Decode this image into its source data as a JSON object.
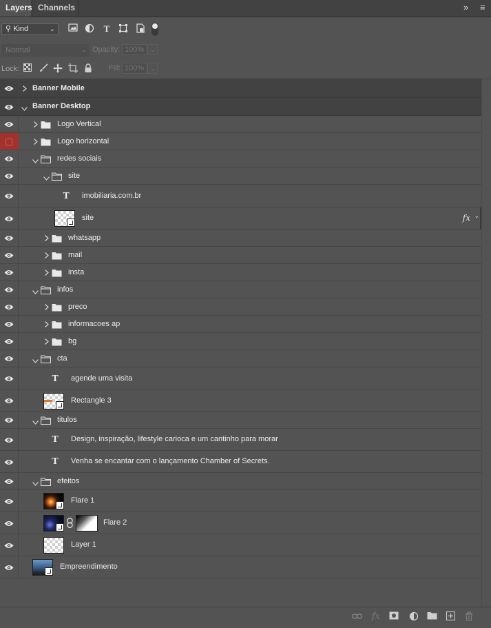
{
  "tabs": [
    {
      "label": "Layers",
      "active": true
    },
    {
      "label": "Channels",
      "active": false
    }
  ],
  "panel_menu": {
    "collapse_glyph": "»",
    "menu_glyph": "≡"
  },
  "filter": {
    "kind_label": "Kind",
    "filter_icons": [
      "image-filter-icon",
      "adjustment-filter-icon",
      "type-filter-icon",
      "shape-filter-icon",
      "smart-object-filter-icon",
      "filter-toggle-icon"
    ]
  },
  "blend": {
    "mode": "Normal",
    "opacity_label": "Opacity:",
    "opacity_value": "100%"
  },
  "lock": {
    "label": "Lock:",
    "fill_label": "Fill:",
    "fill_value": "100%"
  },
  "layers": [
    {
      "name": "Banner Mobile",
      "type": "group",
      "expanded": false,
      "visible": true,
      "bold": true
    },
    {
      "name": "Banner Desktop",
      "type": "group",
      "expanded": true,
      "visible": true,
      "bold": true
    },
    {
      "name": "Logo Vertical",
      "type": "group",
      "expanded": false,
      "visible": true
    },
    {
      "name": "Logo horizontal",
      "type": "group",
      "expanded": false,
      "visible": false,
      "color_tag": "#a3322e"
    },
    {
      "name": "redes sociais",
      "type": "group",
      "expanded": true,
      "visible": true
    },
    {
      "name": "site",
      "type": "group",
      "expanded": true,
      "visible": true
    },
    {
      "name": "imobiliaria.com.br",
      "type": "text",
      "visible": true
    },
    {
      "name": "site",
      "type": "smart",
      "visible": true,
      "fx": "fx"
    },
    {
      "name": "whatsapp",
      "type": "group",
      "expanded": false,
      "visible": true
    },
    {
      "name": "mail",
      "type": "group",
      "expanded": false,
      "visible": true
    },
    {
      "name": "insta",
      "type": "group",
      "expanded": false,
      "visible": true
    },
    {
      "name": "infos",
      "type": "group",
      "expanded": true,
      "visible": true
    },
    {
      "name": "preco",
      "type": "group",
      "expanded": false,
      "visible": true
    },
    {
      "name": "informacoes ap",
      "type": "group",
      "expanded": false,
      "visible": true
    },
    {
      "name": "bg",
      "type": "group",
      "expanded": false,
      "visible": true
    },
    {
      "name": "cta",
      "type": "group",
      "expanded": true,
      "visible": true
    },
    {
      "name": "agende uma visita",
      "type": "text",
      "visible": true
    },
    {
      "name": "Rectangle 3",
      "type": "shape",
      "visible": true
    },
    {
      "name": "titulos",
      "type": "group",
      "expanded": true,
      "visible": true
    },
    {
      "name": "Design, inspiração, lifestyle carioca e um cantinho para morar",
      "type": "text",
      "visible": true
    },
    {
      "name": "Venha se encantar com o lançamento Chamber of Secrets.",
      "type": "text",
      "visible": true
    },
    {
      "name": "efeitos",
      "type": "group",
      "expanded": true,
      "visible": true
    },
    {
      "name": "Flare 1",
      "type": "smart",
      "visible": true
    },
    {
      "name": "Flare 2",
      "type": "smart-masked",
      "visible": true
    },
    {
      "name": "Layer 1",
      "type": "pixel",
      "visible": true
    },
    {
      "name": "Empreendimento",
      "type": "smart",
      "visible": true
    }
  ],
  "bottom_icons": [
    "link-layers-icon",
    "fx-icon",
    "add-mask-icon",
    "adjustment-layer-icon",
    "new-group-icon",
    "new-layer-icon",
    "trash-icon"
  ]
}
